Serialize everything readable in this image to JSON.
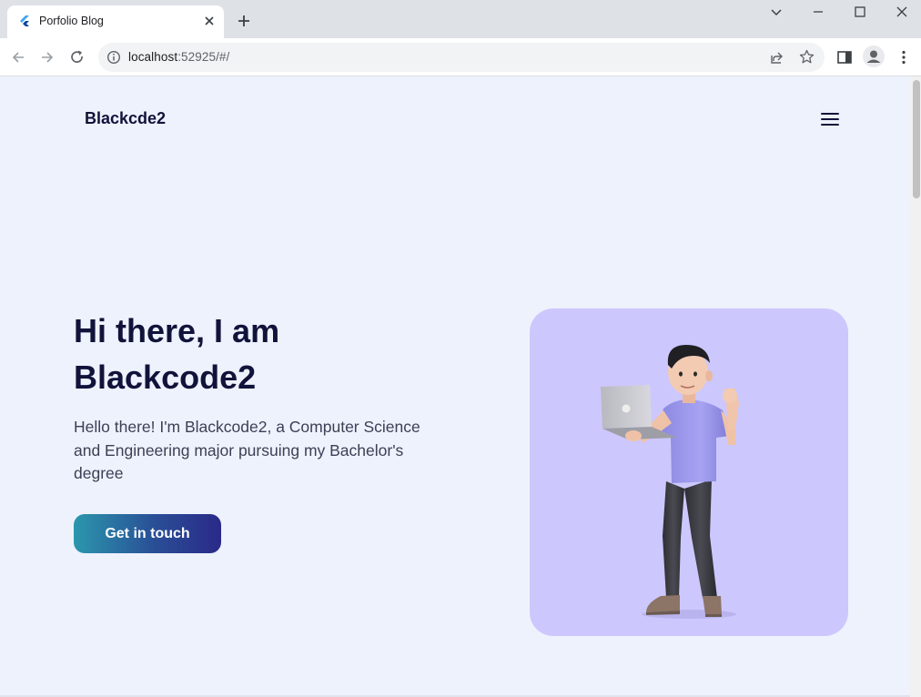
{
  "browser": {
    "tab_title": "Porfolio Blog",
    "url_host": "localhost",
    "url_rest": ":52925/#/"
  },
  "page": {
    "brand": "Blackcde2",
    "hero": {
      "title_line1": "Hi there, I am",
      "title_line2": "Blackcode2",
      "description": "Hello there! I'm Blackcode2, a Computer Science and Engineering major pursuing my Bachelor's degree",
      "cta_label": "Get in touch"
    },
    "colors": {
      "background": "#eef2fd",
      "heading": "#11133a",
      "card": "#ccc8fd",
      "cta_gradient_start": "#2b97ad",
      "cta_gradient_end": "#2a2a88"
    }
  }
}
